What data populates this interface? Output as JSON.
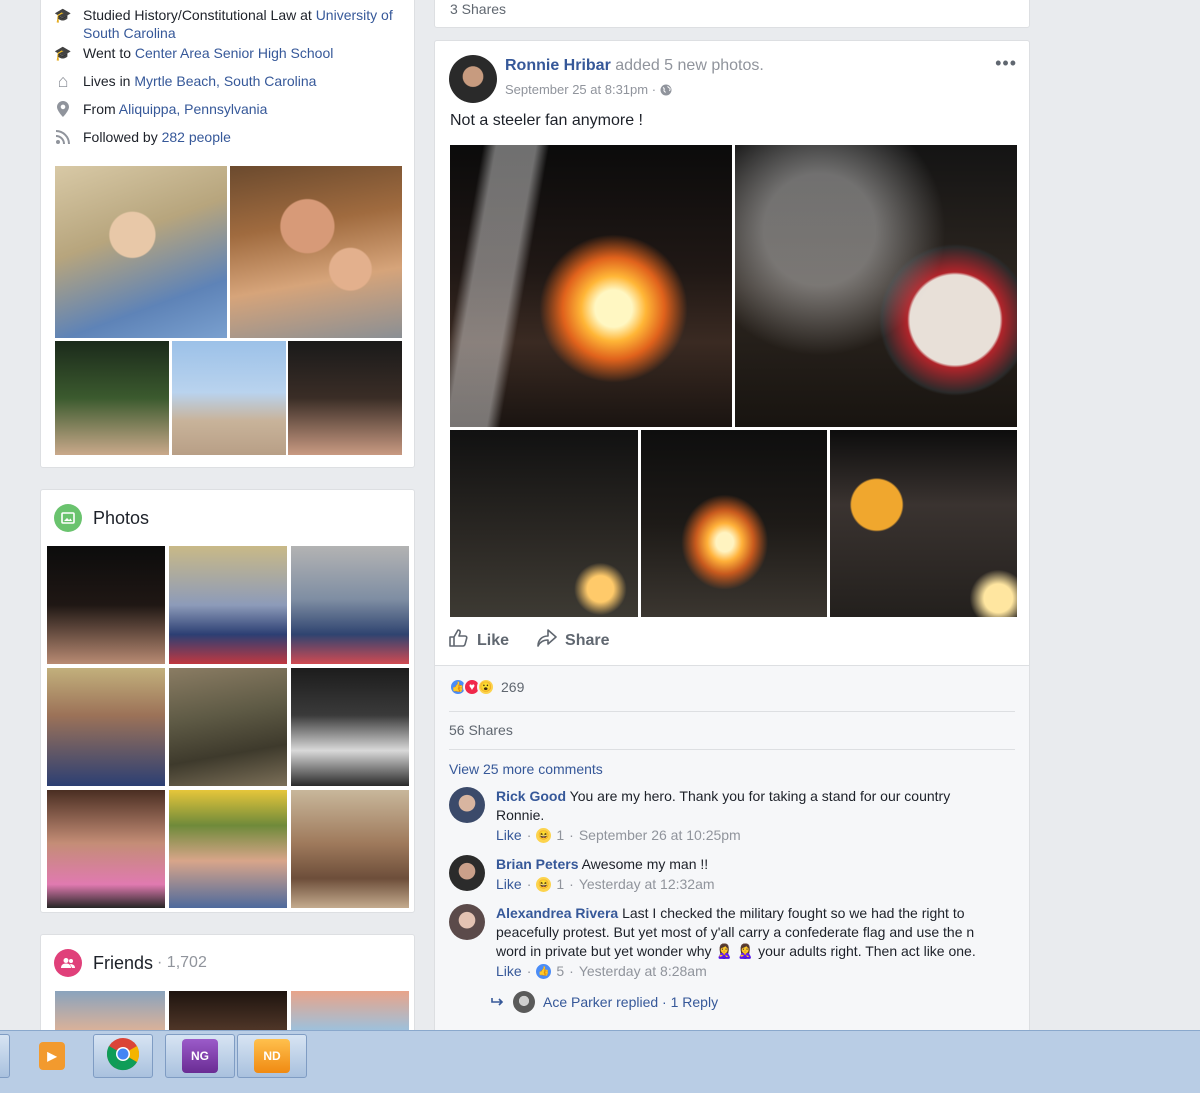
{
  "intro": {
    "rows": [
      {
        "icon": "graduation-cap-icon",
        "glyph": "🎓",
        "prefix": "Studied History/Constitutional Law at ",
        "link": "University of South Carolina"
      },
      {
        "icon": "graduation-cap-icon",
        "glyph": "🎓",
        "prefix": "Went to ",
        "link": "Center Area Senior High School"
      },
      {
        "icon": "home-icon",
        "glyph": "⌂",
        "prefix": "Lives in ",
        "link": "Myrtle Beach, South Carolina"
      },
      {
        "icon": "location-pin-icon",
        "glyph": "⚲",
        "prefix": "From ",
        "link": "Aliquippa, Pennsylvania"
      },
      {
        "icon": "rss-icon",
        "glyph": "≋",
        "prefix": "Followed by ",
        "link": "282 people"
      }
    ]
  },
  "photos_section": {
    "title": "Photos"
  },
  "friends_section": {
    "title": "Friends",
    "count": "· 1,702"
  },
  "top_shares": "3 Shares",
  "post": {
    "author": "Ronnie Hribar",
    "action_text": " added 5 new photos.",
    "timestamp": "September 25 at 8:31pm · ",
    "privacy_icon": "globe-icon",
    "text": "Not a steeler fan anymore !",
    "more_label": "•••",
    "like_label": "Like",
    "share_label": "Share",
    "reaction_count": "269",
    "shares": "56 Shares",
    "view_more": "View 25 more comments",
    "comments": [
      {
        "name": "Rick Good",
        "text": " You are my hero. Thank you for taking a stand for our country Ronnie.",
        "like": "Like",
        "reacts": "1",
        "time": "September 26 at 10:25pm"
      },
      {
        "name": "Brian Peters",
        "text": " Awesome my man !!",
        "like": "Like",
        "reacts": "1",
        "time": "Yesterday at 12:32am"
      },
      {
        "name": "Alexandrea Rivera",
        "text": " Last I checked the military fought so we had the right to peacefully protest. But yet most of y'all carry a confederate flag and use the n word in private but yet wonder why 🙎‍♀️ 🙎‍♀️  your adults right. Then act like one.",
        "like": "Like",
        "reacts": "5",
        "time": "Yesterday at 8:28am"
      }
    ],
    "reply": {
      "text": "Ace Parker replied · 1 Reply"
    }
  },
  "taskbar": {
    "items": [
      {
        "name": "media-player-icon",
        "label": "▶",
        "color": "#f29a2e"
      },
      {
        "name": "chrome-icon",
        "label": "",
        "color": "#ffffff"
      },
      {
        "name": "ng-app-icon",
        "label": "NG",
        "color": "#7b3fa6"
      },
      {
        "name": "nd-app-icon",
        "label": "ND",
        "color": "#f5a623"
      }
    ]
  }
}
